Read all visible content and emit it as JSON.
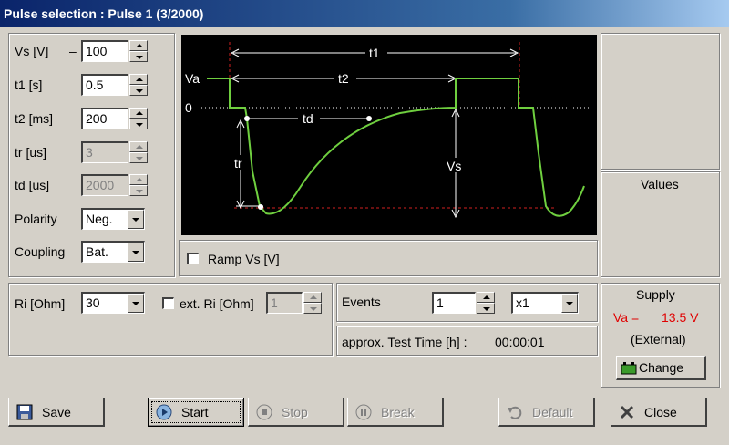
{
  "window": {
    "title": "Pulse selection : Pulse 1 (3/2000)"
  },
  "params": {
    "vs": {
      "label": "Vs [V]",
      "sign": "–",
      "value": "100"
    },
    "t1": {
      "label": "t1 [s]",
      "value": "0.5"
    },
    "t2": {
      "label": "t2 [ms]",
      "value": "200"
    },
    "tr": {
      "label": "tr [us]",
      "value": "3"
    },
    "td": {
      "label": "td [us]",
      "value": "2000"
    },
    "polarity": {
      "label": "Polarity",
      "value": "Neg."
    },
    "coupling": {
      "label": "Coupling",
      "value": "Bat."
    }
  },
  "diagram": {
    "labels": {
      "t1": "t1",
      "t2": "t2",
      "va": "Va",
      "zero": "0",
      "td": "td",
      "tr": "tr",
      "vs": "Vs"
    },
    "colors": {
      "curve": "#6fcf3f",
      "dim": "#ffffff",
      "ref": "#d02020"
    }
  },
  "ramp": {
    "label": "Ramp Vs [V]",
    "checked": false
  },
  "values": {
    "title": "Values"
  },
  "ri": {
    "label": "Ri [Ohm]",
    "value": "30",
    "ext_label": "ext. Ri [Ohm]",
    "ext_value": "1",
    "ext_checked": false
  },
  "events": {
    "label": "Events",
    "value": "1",
    "multiplier": "x1"
  },
  "test_time": {
    "label": "approx. Test Time [h] :",
    "value": "00:00:01"
  },
  "supply": {
    "title": "Supply",
    "va_label": "Va =",
    "va_value": "13.5 V",
    "source": "(External)",
    "change_label": "Change",
    "accent": "#e00000"
  },
  "buttons": {
    "save": "Save",
    "start": "Start",
    "stop": "Stop",
    "break": "Break",
    "default": "Default",
    "close": "Close"
  }
}
